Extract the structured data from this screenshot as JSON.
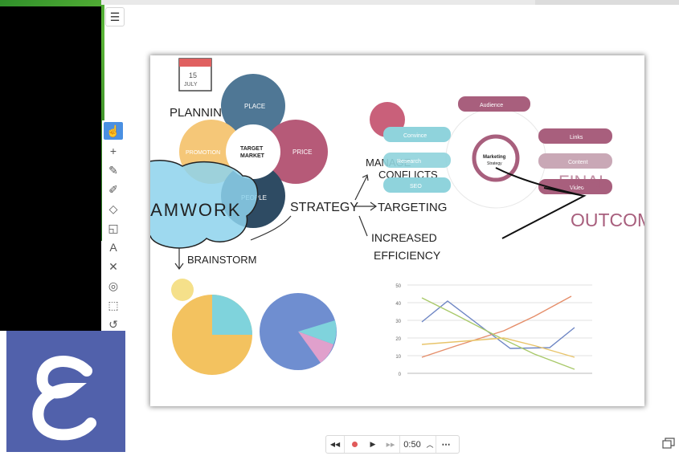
{
  "toolbar": {
    "menu_icon": "hamburger-icon",
    "tools": [
      "hand-icon",
      "plus-icon",
      "pen-icon",
      "marker-icon",
      "eraser-icon",
      "shapes-icon",
      "text-icon",
      "close-icon",
      "target-icon",
      "select-icon",
      "undo-icon"
    ]
  },
  "canvas": {
    "date_month": "JULY",
    "date_day": "15",
    "planning": "PLANNING",
    "place": "PLACE",
    "price": "PRICE",
    "promotion": "PROMOTION",
    "people": "PEOPLE",
    "target_market_1": "TARGET",
    "target_market_2": "MARKET",
    "teamwork": "TEAMWORK",
    "brainstorm": "BRAINSTORM",
    "strategy": "STRATEGY",
    "targeting": "TARGETING",
    "increased_1": "INCREASED",
    "increased_2": "EFFICIENCY",
    "manage_1": "MANAGE",
    "manage_2": "CONFLICTS",
    "final": "FINAL",
    "outcome": "OUTCOME",
    "audience": "Audience",
    "convince": "Convince",
    "research": "Research",
    "seo": "SEO",
    "links": "Links",
    "content": "Content",
    "video": "Video",
    "marketing_1": "Marketing",
    "marketing_2": "Strategy"
  },
  "line_chart": {
    "y_ticks": [
      "50",
      "40",
      "30",
      "20",
      "10",
      "0"
    ],
    "colors": [
      "#6e86c4",
      "#e58e6a",
      "#a9c96a",
      "#e8c46a"
    ]
  },
  "playbar": {
    "rewind_icon": "rewind-icon",
    "record_icon": "record-icon",
    "play_icon": "play-icon",
    "forward_icon": "fast-forward-icon",
    "time": "0:50",
    "chevron_icon": "chevron-up-icon",
    "more_icon": "more-icon"
  },
  "colors": {
    "blue_circle": "#4f7795",
    "red_circle": "#b65a78",
    "yellow_circle": "#f5c778",
    "navy_circle": "#2e4b63",
    "light_blue": "#8fd3dc",
    "mauve": "#a85f7d",
    "pie_yellow": "#f3c25f",
    "pie_cyan": "#7fd3dc",
    "pie_blue": "#6f8ed0",
    "pie_pink": "#e0a0cc",
    "logo_bg": "#5161ab"
  }
}
